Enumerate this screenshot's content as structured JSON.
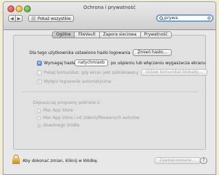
{
  "window": {
    "title": "Ochrona i prywatność"
  },
  "toolbar": {
    "back": "◀",
    "forward": "▶",
    "show_all": "Pokaż wszystkie",
    "search_value": "prywa",
    "search_clear": "✕"
  },
  "tabs": [
    {
      "label": "Ogólne",
      "active": true
    },
    {
      "label": "FileVault",
      "active": false
    },
    {
      "label": "Zapora sieciowa",
      "active": false
    },
    {
      "label": "Prywatność",
      "active": false
    }
  ],
  "general": {
    "password_set_text": "Dla tego użytkownika ustawiono hasło logowania",
    "change_password_button": "Zmień hasło…",
    "require_password": {
      "checked": true,
      "label_before": "Wymagaj hasła",
      "delay_value": "natychmiast",
      "label_after": "po uśpieniu lub włączeniu wygaszacza ekranu"
    },
    "show_message": {
      "checked": false,
      "label": "Pokaż komunikat, gdy ekran jest zablokowany",
      "button": "Ustaw komunikat blokady…"
    },
    "disable_autologin": {
      "checked": true,
      "label": "Wyłącz logowanie automatyczne"
    },
    "downloads": {
      "heading": "Dopuszczaj programy pobrane z:",
      "options": [
        {
          "label": "Mac App Store",
          "selected": false
        },
        {
          "label": "Mac App Store i od zidentyfikowanych autorów",
          "selected": false
        },
        {
          "label": "dowolnego źródła",
          "selected": true
        }
      ]
    }
  },
  "footer": {
    "lock_text": "Aby dokonać zmian, kliknij w kłódkę.",
    "advanced_button": "Zaawansowane…",
    "help_button": "?"
  }
}
